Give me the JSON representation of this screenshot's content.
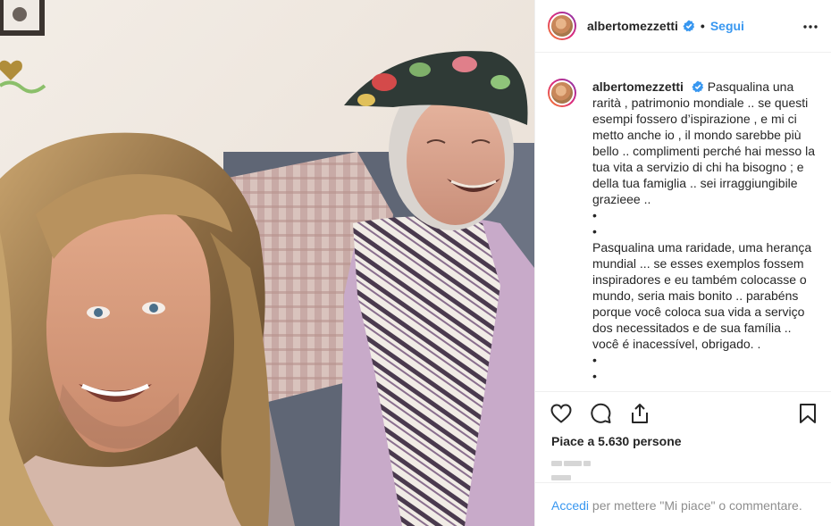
{
  "header": {
    "username": "albertomezzetti",
    "separator": "•",
    "follow_label": "Segui"
  },
  "caption": {
    "username": "albertomezzetti",
    "italian_text": "Pasqualina una rarità , patrimonio mondiale .. se questi esempi fossero d’ispirazione , e mi ci metto anche io , il mondo sarebbe più bello .. complimenti perché hai messo la tua vita a servizio di chi ha bisogno ; e della tua famiglia .. sei irraggiungibile grazieee ..",
    "bullets_1": [
      "•",
      "•"
    ],
    "portuguese_text": "Pasqualina uma raridade, uma herança mundial ... se esses exemplos fossem inspiradores e eu também colocasse o mundo, seria mais bonito .. parabéns porque você coloca sua vida a serviço dos necessitados e de sua família .. você é inacessível, obrigado. .",
    "bullets_2": [
      "•",
      "•"
    ]
  },
  "actions": {
    "like_icon": "heart-icon",
    "comment_icon": "comment-bubble-icon",
    "share_icon": "share-icon",
    "save_icon": "bookmark-icon"
  },
  "likes_text": "Piace a 5.630 persone",
  "footer": {
    "login_link": "Accedi",
    "login_rest": " per mettere \"Mi piace\" o commentare."
  },
  "colors": {
    "link_blue": "#3897f0",
    "verified_blue": "#3897f0",
    "text": "#262626",
    "muted": "#8e8e8e",
    "border": "#efefef"
  }
}
